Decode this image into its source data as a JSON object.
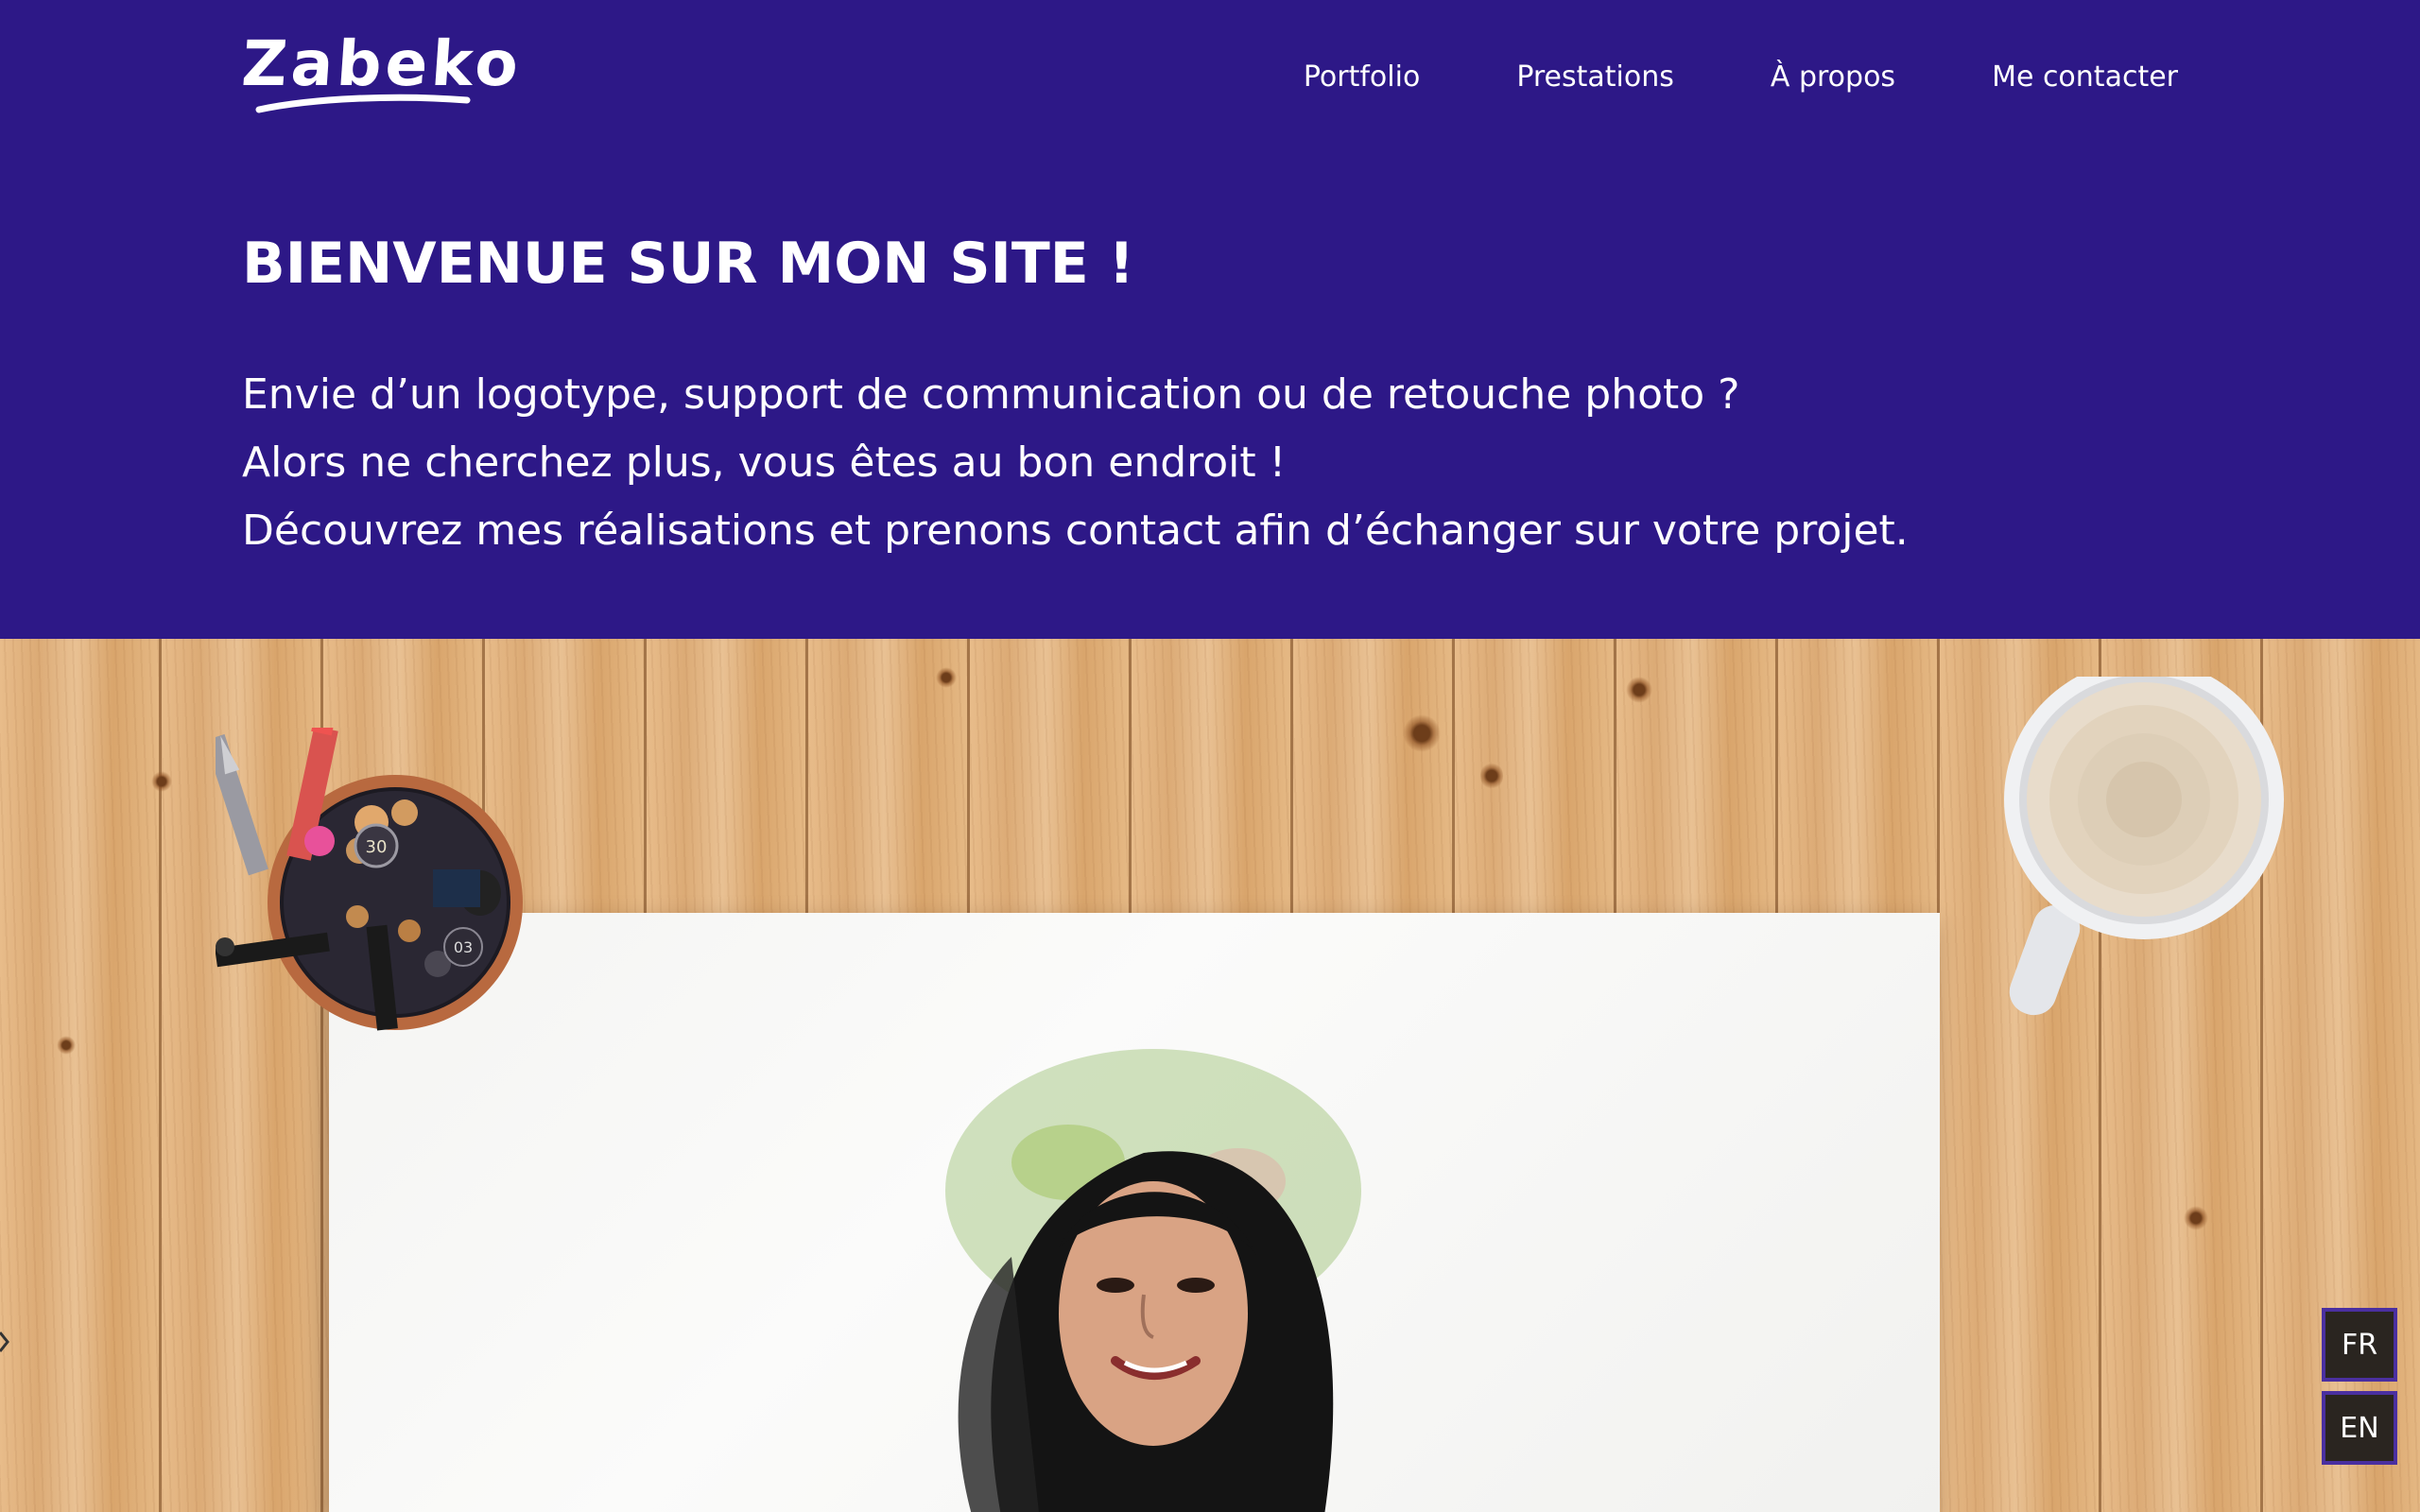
{
  "header": {
    "logo_text": "Zabeko",
    "nav": [
      {
        "label": "Portfolio"
      },
      {
        "label": "Prestations"
      },
      {
        "label": "À propos"
      },
      {
        "label": "Me contacter"
      }
    ]
  },
  "hero": {
    "title": "BIENVENUE SUR MON SITE !",
    "lines": [
      "Envie d’un logotype, support de communication ou de retouche photo ?",
      "Alors ne cherchez plus, vous êtes au bon endroit !",
      "Découvrez mes réalisations et prenons contact afin d’échanger sur votre projet."
    ]
  },
  "illustration": {
    "pencil_cup_labels": [
      "30",
      "03"
    ]
  },
  "language_switch": {
    "options": [
      {
        "label": "FR"
      },
      {
        "label": "EN"
      }
    ]
  },
  "colors": {
    "brand_purple": "#2d1887",
    "text_white": "#ffffff",
    "lang_button_bg": "#2a2520",
    "lang_button_border": "#4a2fa0"
  }
}
